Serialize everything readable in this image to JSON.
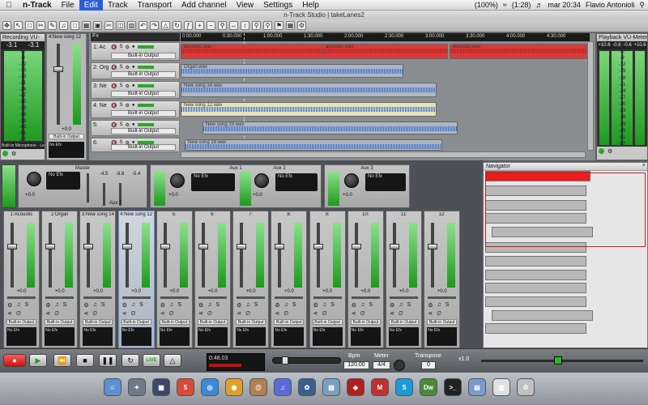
{
  "menubar": {
    "app": "n-Track",
    "items": [
      "File",
      "Edit",
      "Track",
      "Transport",
      "Add channel",
      "View",
      "Settings",
      "Help"
    ],
    "active": "Edit",
    "battery": "(100%)",
    "clock_status": "(1:28)",
    "datetime": "mar 20:34",
    "user": "Flavio Antonioli"
  },
  "window": {
    "title": "n-Track Studio | takeLanes2"
  },
  "recording_vu": {
    "title": "Recording VU-",
    "values": [
      "-3.1",
      "-3.1"
    ],
    "scale": [
      "-6",
      "-9",
      "-12",
      "-15",
      "-18",
      "-21",
      "-24",
      "-27",
      "-30",
      "-33",
      "-36",
      "-39",
      "-45",
      "-51",
      "-57"
    ],
    "input": "Built-in Microphone - Left"
  },
  "playback_vu": {
    "title": "Playback VU-Meter",
    "values": [
      "+10.6",
      "-0.6",
      "-0.6",
      "+10.6"
    ],
    "scale": [
      "-6",
      "-9",
      "-12",
      "-15",
      "-18",
      "-21",
      "-24",
      "-27",
      "-30",
      "-33",
      "-36",
      "-39",
      "-45",
      "-51",
      "-57"
    ]
  },
  "mini_strip": {
    "name": "4:New song",
    "num": "12",
    "value": "+0.0",
    "output": "Built-in Output",
    "efx": "No Efx"
  },
  "ruler": {
    "ticks": [
      "0:00.000",
      "0:30.000",
      "1:00.000",
      "1:30.000",
      "2:00.000",
      "2:30.000",
      "3:00.000",
      "3:30.000",
      "4:00.000",
      "4:30.000"
    ]
  },
  "tracks": [
    {
      "name": "1: Ac",
      "output": "Built-in Output",
      "clips": [
        "acoustic.wav",
        "acoustic.wav",
        "acoustic.wav"
      ]
    },
    {
      "name": "2: Org",
      "output": "Built-in Output",
      "clips": [
        "Organ.wav"
      ]
    },
    {
      "name": "3: Ne",
      "output": "Built-in Output",
      "clips": [
        "New song 14.wav"
      ]
    },
    {
      "name": "4: Ne",
      "output": "Built-in Output",
      "clips": [
        "New song 12.wav"
      ]
    },
    {
      "name": "5:",
      "output": "Built-in Output",
      "clips": [
        "New song 19.wav"
      ]
    },
    {
      "name": "6:",
      "output": "Built-in Output",
      "clips": [
        "New song 19.wav"
      ]
    }
  ],
  "buses": [
    {
      "name": "Master",
      "efx": "No Efx",
      "val1": "+0.0",
      "val2": "-4.5",
      "val3": "-8.8",
      "val4": "-5.4",
      "sub": "Aux 2"
    },
    {
      "name": "Aux 1",
      "efx": "No Efx",
      "val": "+0.0"
    },
    {
      "name": "Aux 2",
      "efx": "No Efx",
      "val": "+0.0"
    },
    {
      "name": "Aux 3",
      "efx": "No Efx",
      "val": "+0.0"
    }
  ],
  "channels": [
    {
      "name": "1:Acoustic",
      "val": "+0.0",
      "output": "Built-in Output",
      "efx": "No Efx"
    },
    {
      "name": "2:Organ",
      "val": "+0.0",
      "output": "Built-in Output",
      "efx": "No Efx"
    },
    {
      "name": "3:New song  14",
      "val": "+0.0",
      "output": "Built-in Output",
      "efx": "No Efx"
    },
    {
      "name": "4:New song  12",
      "val": "+0.0",
      "output": "Built-in Output",
      "efx": "No Efx"
    },
    {
      "name": "5:",
      "val": "+0.0",
      "output": "Built-in Output",
      "efx": "No Efx"
    },
    {
      "name": "6:",
      "val": "+0.0",
      "output": "Built-in Output",
      "efx": "No Efx"
    },
    {
      "name": "7:",
      "val": "+0.0",
      "output": "Built-in Output",
      "efx": "No Efx"
    },
    {
      "name": "8:",
      "val": "+0.0",
      "output": "Built-in Output",
      "efx": "No Efx"
    },
    {
      "name": "9:",
      "val": "+0.0",
      "output": "Built-in Output",
      "efx": "No Efx"
    },
    {
      "name": "10:",
      "val": "+0.0",
      "output": "Built-in Output",
      "efx": "No Efx"
    },
    {
      "name": "11:",
      "val": "+0.0",
      "output": "Built-in Output",
      "efx": "No Efx"
    },
    {
      "name": "12:",
      "val": "+0.0",
      "output": "Built-in Output",
      "efx": "No Efx"
    }
  ],
  "navigator": {
    "title": "Navigator"
  },
  "transport": {
    "live": "LIVE",
    "time": "0:48.03",
    "bpm_label": "Bpm",
    "bpm": "120.00",
    "meter_label": "Meter",
    "meter": "4/4",
    "transpose_label": "Transpose",
    "transpose": "0",
    "zoom": "x1.0"
  },
  "dock": [
    "Finder",
    "Launchpad",
    "Mission Control",
    "iCal",
    "Safari",
    "Chrome",
    "Address Book",
    "iTunes",
    "iPhoto",
    "Preview",
    "Photo Booth",
    "MAMP",
    "Skype",
    "Dreamweaver",
    "Terminal",
    "Folder",
    "Documents",
    "Trash"
  ],
  "colors": {
    "accent": "#2b5ed6",
    "record": "#e62222",
    "clip_red": "#d83a3a",
    "clip_blue": "#3a72d6",
    "meter_green": "#2aa82a"
  }
}
